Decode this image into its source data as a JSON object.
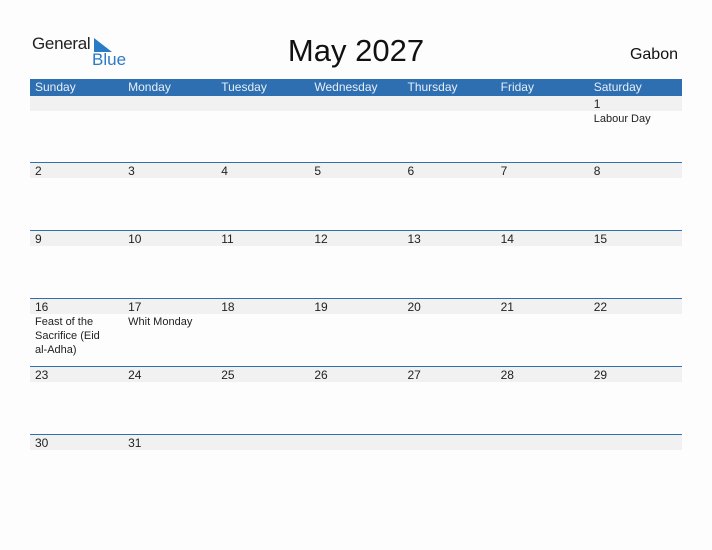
{
  "logo": {
    "general": "General",
    "blue": "Blue"
  },
  "title": "May 2027",
  "country": "Gabon",
  "weekdays": [
    "Sunday",
    "Monday",
    "Tuesday",
    "Wednesday",
    "Thursday",
    "Friday",
    "Saturday"
  ],
  "weeks": [
    [
      {
        "d": ""
      },
      {
        "d": ""
      },
      {
        "d": ""
      },
      {
        "d": ""
      },
      {
        "d": ""
      },
      {
        "d": ""
      },
      {
        "d": "1",
        "e": "Labour Day"
      }
    ],
    [
      {
        "d": "2"
      },
      {
        "d": "3"
      },
      {
        "d": "4"
      },
      {
        "d": "5"
      },
      {
        "d": "6"
      },
      {
        "d": "7"
      },
      {
        "d": "8"
      }
    ],
    [
      {
        "d": "9"
      },
      {
        "d": "10"
      },
      {
        "d": "11"
      },
      {
        "d": "12"
      },
      {
        "d": "13"
      },
      {
        "d": "14"
      },
      {
        "d": "15"
      }
    ],
    [
      {
        "d": "16",
        "e": "Feast of the Sacrifice (Eid al-Adha)"
      },
      {
        "d": "17",
        "e": "Whit Monday"
      },
      {
        "d": "18"
      },
      {
        "d": "19"
      },
      {
        "d": "20"
      },
      {
        "d": "21"
      },
      {
        "d": "22"
      }
    ],
    [
      {
        "d": "23"
      },
      {
        "d": "24"
      },
      {
        "d": "25"
      },
      {
        "d": "26"
      },
      {
        "d": "27"
      },
      {
        "d": "28"
      },
      {
        "d": "29"
      }
    ],
    [
      {
        "d": "30"
      },
      {
        "d": "31"
      },
      {
        "d": ""
      },
      {
        "d": ""
      },
      {
        "d": ""
      },
      {
        "d": ""
      },
      {
        "d": ""
      }
    ]
  ],
  "colors": {
    "accent": "#2e6fb1",
    "strip": "#f1f1f1"
  }
}
